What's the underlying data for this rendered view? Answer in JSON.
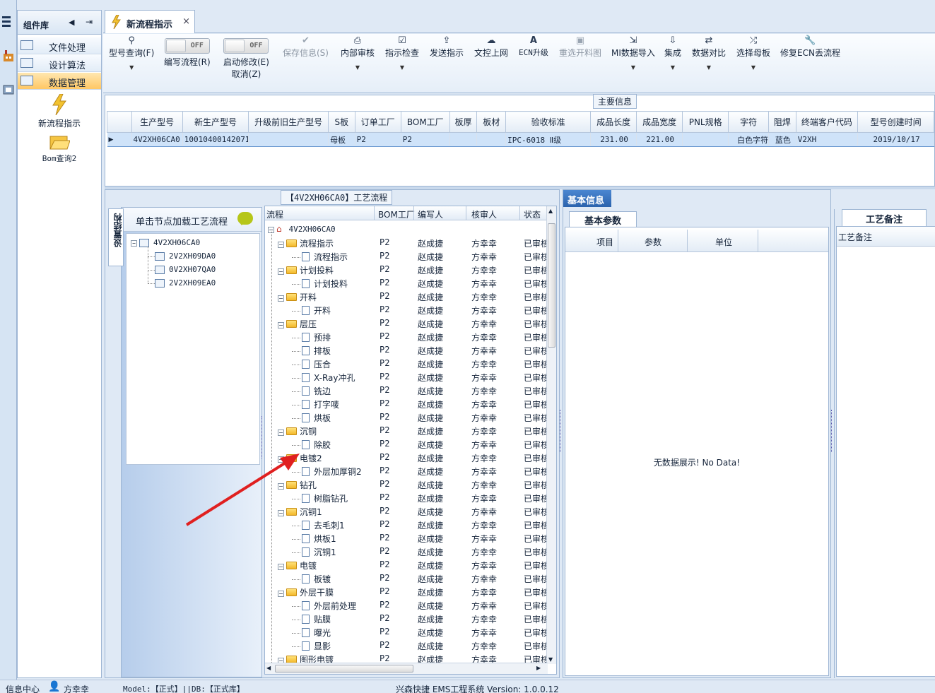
{
  "sidebar": {
    "title": "组件库",
    "items": [
      {
        "label": "文件处理"
      },
      {
        "label": "设计算法"
      },
      {
        "label": "数据管理"
      }
    ],
    "tiles": [
      {
        "label": "新流程指示"
      },
      {
        "label": "Bom查询2"
      }
    ]
  },
  "tab": {
    "label": "新流程指示",
    "close": "×"
  },
  "toolbar": {
    "model_query": "型号查询(F)",
    "write_flow": "编写流程(R)",
    "start_modify": "启动修改(E)",
    "cancel": "取消(Z)",
    "toggle_off": "OFF",
    "save_info": "保存信息(S)",
    "internal_review": "内部审核",
    "indicate_check": "指示检查",
    "send_indicate": "发送指示",
    "doc_upload": "文控上网",
    "ecn_upgrade": "ECN升级",
    "reselect_chart": "重选开料图",
    "mi_import": "MI数据导入",
    "integrate": "集成",
    "data_compare": "数据对比",
    "select_mother": "选择母板",
    "repair_ecn": "修复ECN丢流程"
  },
  "main_info": {
    "caption": "主要信息",
    "columns": [
      "生产型号",
      "新生产型号",
      "升级前旧生产型号",
      "S板",
      "订单工厂",
      "BOM工厂",
      "板厚",
      "板材",
      "验收标准",
      "成品长度",
      "成品宽度",
      "PNL规格",
      "字符",
      "阻焊",
      "终端客户代码",
      "型号创建时间"
    ],
    "row": [
      "4V2XH06CA0",
      "10010400142071",
      "",
      "母板",
      "P2",
      "P2",
      "",
      "",
      "IPC-6018 Ⅱ级",
      "231.00",
      "221.00",
      "",
      "白色字符",
      "蓝色",
      "V2XH",
      "2019/10/17"
    ]
  },
  "process": {
    "caption": "【4V2XH06CA0】工艺流程",
    "vtab": "设置结构",
    "hint": "单击节点加载工艺流程",
    "left_tree": {
      "root": "4V2XH06CA0",
      "children": [
        "2V2XH09DA0",
        "0V2XH07QA0",
        "2V2XH09EA0"
      ]
    },
    "columns": [
      "流程",
      "BOM工厂",
      "编写人",
      "核审人",
      "状态"
    ],
    "root": "4V2XH06CA0",
    "factory": "P2",
    "writer": "赵成捷",
    "reviewer": "方幸幸",
    "status": "已审核",
    "rows": [
      {
        "name": "流程指示",
        "folder": true
      },
      {
        "name": "流程指示",
        "folder": false
      },
      {
        "name": "计划投料",
        "folder": true
      },
      {
        "name": "计划投料",
        "folder": false
      },
      {
        "name": "开料",
        "folder": true
      },
      {
        "name": "开料",
        "folder": false
      },
      {
        "name": "层压",
        "folder": true
      },
      {
        "name": "预排",
        "folder": false
      },
      {
        "name": "排板",
        "folder": false
      },
      {
        "name": "压合",
        "folder": false
      },
      {
        "name": "X-Ray冲孔",
        "folder": false
      },
      {
        "name": "铣边",
        "folder": false
      },
      {
        "name": "打字唛",
        "folder": false
      },
      {
        "name": "烘板",
        "folder": false
      },
      {
        "name": "沉铜",
        "folder": true
      },
      {
        "name": "除胶",
        "folder": false
      },
      {
        "name": "电镀2",
        "folder": true
      },
      {
        "name": "外层加厚铜2",
        "folder": false
      },
      {
        "name": "钻孔",
        "folder": true
      },
      {
        "name": "树脂钻孔",
        "folder": false
      },
      {
        "name": "沉铜1",
        "folder": true
      },
      {
        "name": "去毛刺1",
        "folder": false
      },
      {
        "name": "烘板1",
        "folder": false
      },
      {
        "name": "沉铜1",
        "folder": false
      },
      {
        "name": "电镀",
        "folder": true
      },
      {
        "name": "板镀",
        "folder": false
      },
      {
        "name": "外层干膜",
        "folder": true
      },
      {
        "name": "外层前处理",
        "folder": false
      },
      {
        "name": "贴膜",
        "folder": false
      },
      {
        "name": "曝光",
        "folder": false
      },
      {
        "name": "显影",
        "folder": false
      },
      {
        "name": "图形电镀",
        "folder": true
      }
    ]
  },
  "basic_info": {
    "tab": "基本信息",
    "subtab": "基本参数",
    "columns": [
      "项目",
      "参数",
      "单位"
    ],
    "empty": "无数据展示! No Data!"
  },
  "notes": {
    "tab": "工艺备注",
    "header": "工艺备注"
  },
  "status_bar": {
    "info_center": "信息中心",
    "user": "方幸幸",
    "model": "Model:【正式】||DB:【正式库】",
    "system": "兴森快捷 EMS工程系统 Version: 1.0.0.12"
  }
}
